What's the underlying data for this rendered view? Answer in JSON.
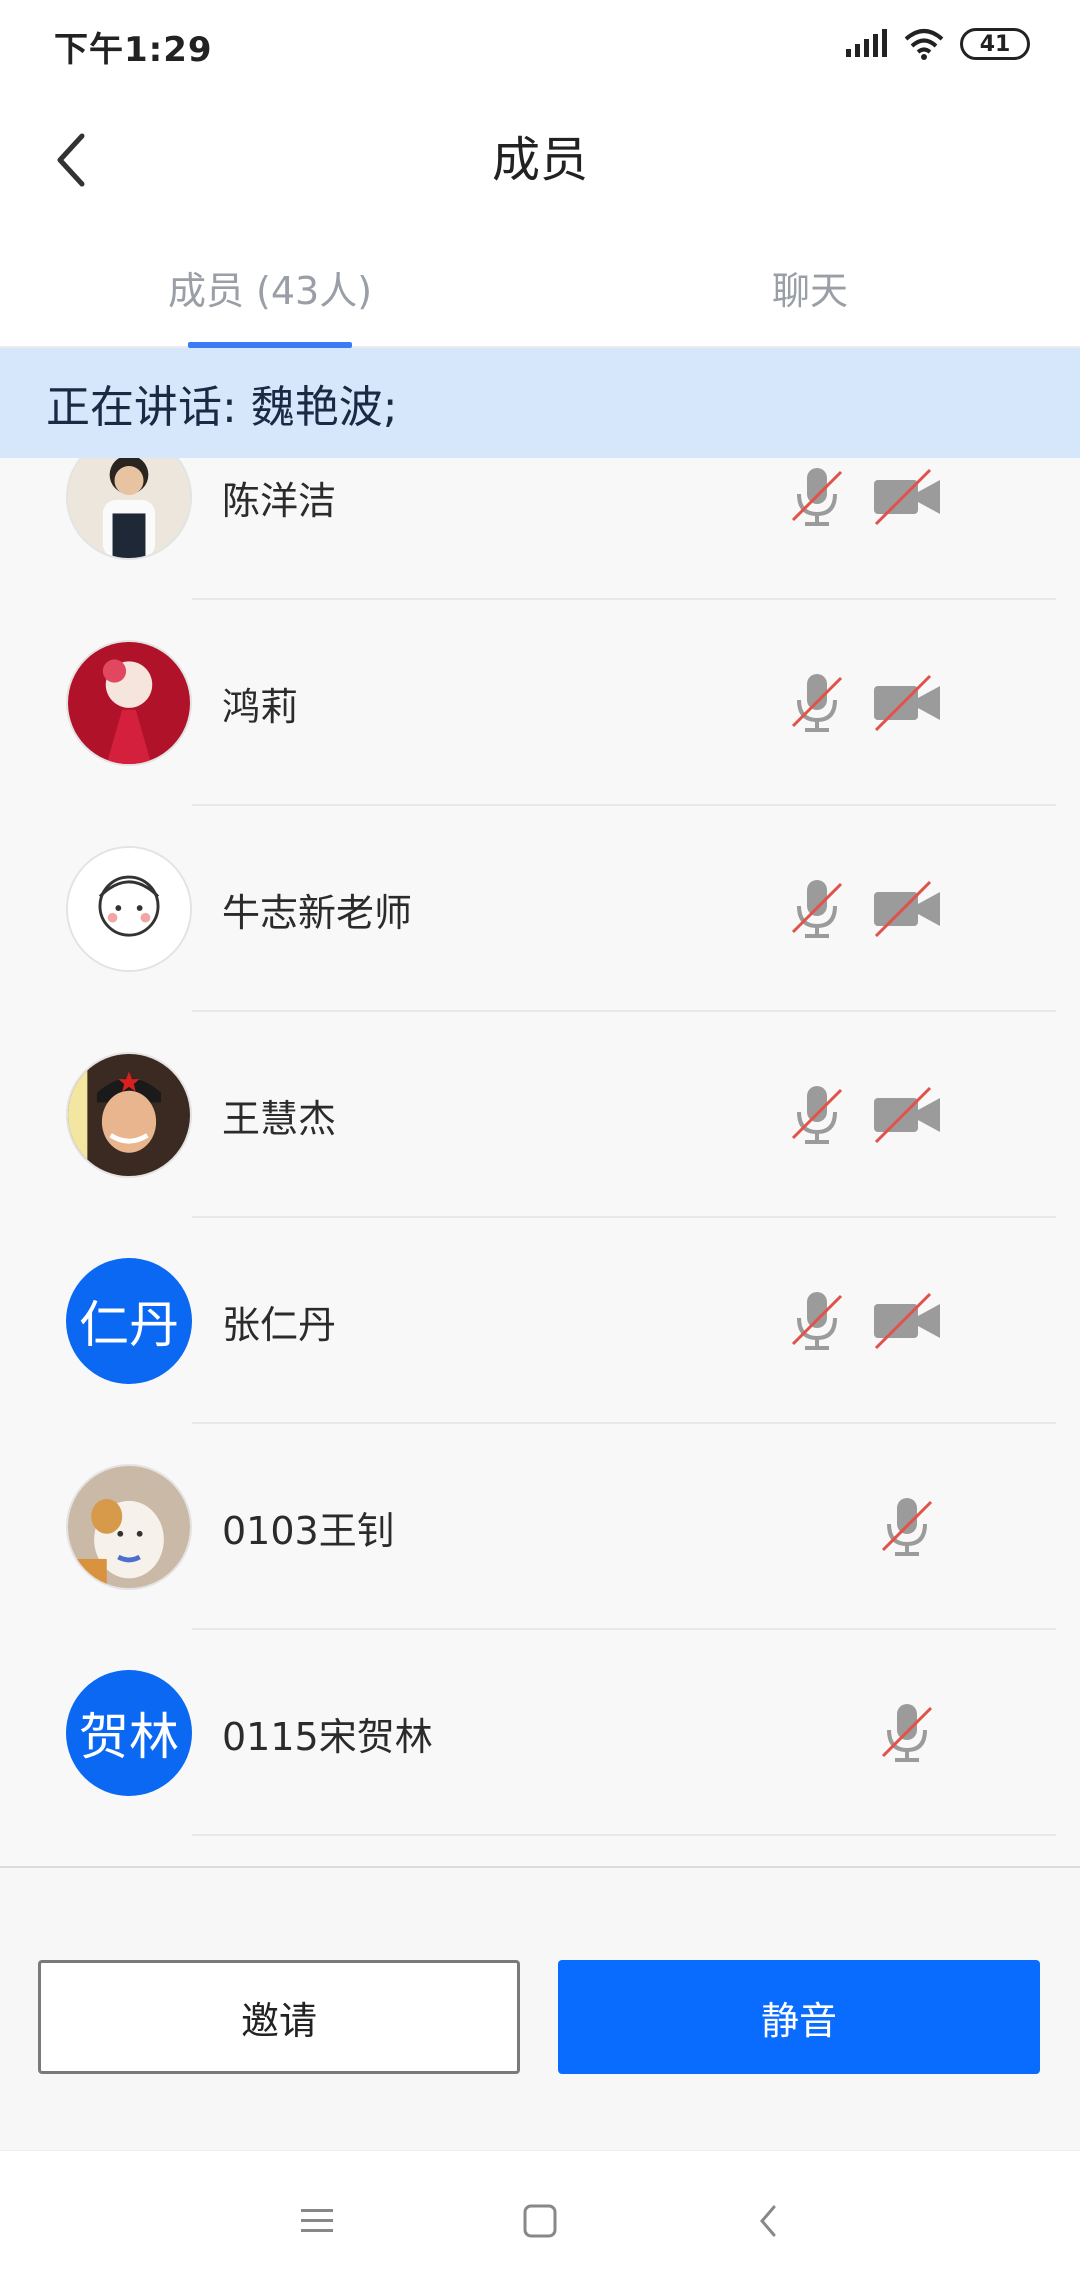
{
  "status_bar": {
    "time": "下午1:29",
    "battery": "41"
  },
  "header": {
    "title": "成员",
    "back_icon": "chevron-left-icon"
  },
  "tabs": [
    {
      "label": "成员 (43人)",
      "active": true
    },
    {
      "label": "聊天",
      "active": false
    }
  ],
  "speaking": {
    "text": "正在讲话: 魏艳波;"
  },
  "members": [
    {
      "name": "陈洋洁",
      "avatar": "photo",
      "mic": "muted",
      "camera": "off"
    },
    {
      "name": "鸿莉",
      "avatar": "photo",
      "mic": "muted",
      "camera": "off"
    },
    {
      "name": "牛志新老师",
      "avatar": "photo",
      "mic": "muted",
      "camera": "off"
    },
    {
      "name": "王慧杰",
      "avatar": "photo",
      "mic": "muted",
      "camera": "off"
    },
    {
      "name": "张仁丹",
      "avatar_text": "仁丹",
      "mic": "muted",
      "camera": "off"
    },
    {
      "name": "0103王钊",
      "avatar": "photo",
      "mic": "muted"
    },
    {
      "name": "0115宋贺林",
      "avatar_text": "贺林",
      "mic": "muted"
    }
  ],
  "actions": {
    "invite": "邀请",
    "mute": "静音"
  },
  "colors": {
    "accent": "#0a6cff",
    "banner": "#d6e6fb",
    "muted_slash": "#e0524a"
  }
}
